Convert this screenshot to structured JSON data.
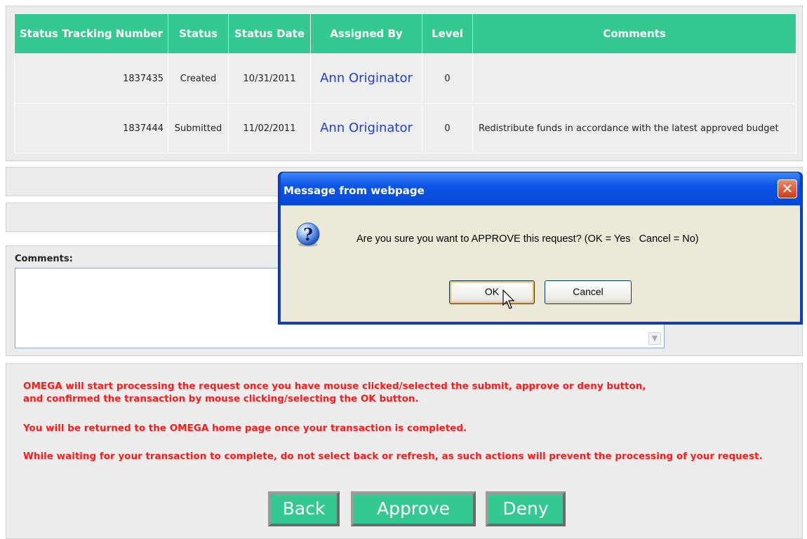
{
  "table": {
    "headers": [
      {
        "label": "Status Tracking Number"
      },
      {
        "label": "Status"
      },
      {
        "label": "Status Date"
      },
      {
        "label": "Assigned By"
      },
      {
        "label": "Level"
      },
      {
        "label": "Comments"
      }
    ],
    "rows": [
      {
        "number": "1837435",
        "status": "Created",
        "date": "10/31/2011",
        "assigned": "Ann Originator",
        "level": "0",
        "comment": ""
      },
      {
        "number": "1837444",
        "status": "Submitted",
        "date": "11/02/2011",
        "assigned": "Ann Originator",
        "level": "0",
        "comment": "Redistribute funds in accordance with the latest approved budget"
      }
    ]
  },
  "comments": {
    "label": "Comments:",
    "value": ""
  },
  "notices": [
    "OMEGA will start processing the request once you have mouse clicked/selected the submit, approve or deny button,\nand confirmed the transaction by mouse clicking/selecting the OK button.",
    "You will be returned to the OMEGA home page once your transaction is completed.",
    "While waiting for your transaction to complete, do not select back or refresh, as such actions will prevent the processing of your request."
  ],
  "buttons": {
    "back": "Back",
    "approve": "Approve",
    "deny": "Deny"
  },
  "dialog": {
    "title": "Message from webpage",
    "message": "Are you sure you want to APPROVE this request? (OK = Yes   Cancel = No)",
    "ok": "OK",
    "cancel": "Cancel",
    "icon": "question-icon",
    "close_icon": "close-icon"
  },
  "colors": {
    "accent": "#33c991",
    "notice": "#ff1a1a",
    "link": "#1e3fd6"
  }
}
